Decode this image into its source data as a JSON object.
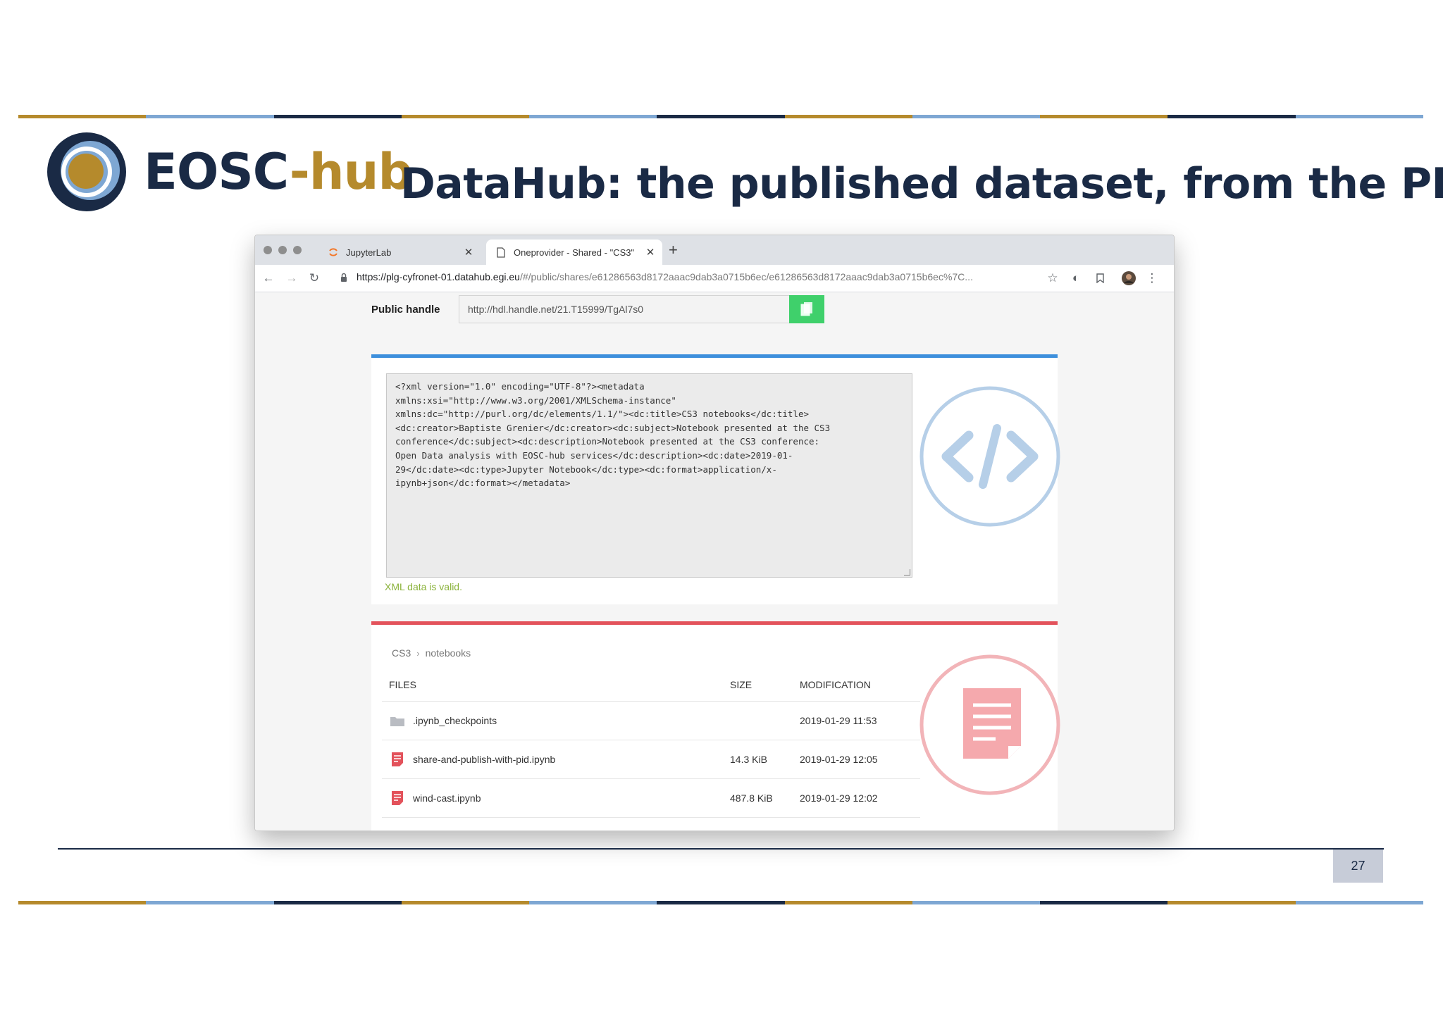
{
  "slide": {
    "logo": {
      "part1": "EOSC",
      "part2": "-hub"
    },
    "title": "DataHub: the published dataset, from the PID",
    "page_number": "27",
    "colors": {
      "navy": "#1a2a45",
      "gold": "#b58a2c",
      "light_blue": "#7ea7d3"
    }
  },
  "browser": {
    "tabs": [
      {
        "label": "JupyterLab",
        "icon": "jupyter-spinner-icon",
        "active": false
      },
      {
        "label": "Oneprovider - Shared - \"CS3\"",
        "icon": "document-icon",
        "active": true
      }
    ],
    "url_main": "https://plg-cyfronet-01.datahub.egi.eu",
    "url_rest": "/#/public/shares/e61286563d8172aaac9dab3a0715b6ec/e61286563d8172aaac9dab3a0715b6ec%7C...",
    "toolbar_icons": [
      "back-arrow-icon",
      "forward-arrow-icon",
      "reload-icon",
      "lock-icon",
      "star-icon",
      "extension-icon",
      "bookmark-icon",
      "profile-avatar",
      "more-menu-icon"
    ]
  },
  "share": {
    "public_handle_label": "Public handle",
    "public_handle_value": "http://hdl.handle.net/21.T15999/TgAl7s0",
    "xml_text": "<?xml version=\"1.0\" encoding=\"UTF-8\"?><metadata xmlns:xsi=\"http://www.w3.org/2001/XMLSchema-instance\" xmlns:dc=\"http://purl.org/dc/elements/1.1/\"><dc:title>CS3 notebooks</dc:title><dc:creator>Baptiste Grenier</dc:creator><dc:subject>Notebook presented at the CS3 conference</dc:subject><dc:description>Notebook presented at the CS3 conference: Open Data analysis with EOSC-hub services</dc:description><dc:date>2019-01-29</dc:date><dc:type>Jupyter Notebook</dc:type><dc:format>application/x-ipynb+json</dc:format></metadata>",
    "xml_lines": [
      "<?xml version=\"1.0\" encoding=\"UTF-8\"?><metadata",
      "xmlns:xsi=\"http://www.w3.org/2001/XMLSchema-instance\"",
      "xmlns:dc=\"http://purl.org/dc/elements/1.1/\"><dc:title>CS3 notebooks</dc:title>",
      "<dc:creator>Baptiste Grenier</dc:creator><dc:subject>Notebook presented at the CS3",
      "conference</dc:subject><dc:description>Notebook presented at the CS3 conference:",
      "Open Data analysis with EOSC-hub services</dc:description><dc:date>2019-01-",
      "29</dc:date><dc:type>Jupyter Notebook</dc:type><dc:format>application/x-",
      "ipynb+json</dc:format></metadata>"
    ],
    "xml_status": "XML data is valid.",
    "breadcrumb": [
      "CS3",
      "notebooks"
    ],
    "columns": {
      "files": "FILES",
      "size": "SIZE",
      "modification": "MODIFICATION"
    },
    "files": [
      {
        "name": ".ipynb_checkpoints",
        "size": "",
        "modified": "2019-01-29 11:53",
        "type": "folder"
      },
      {
        "name": "share-and-publish-with-pid.ipynb",
        "size": "14.3 KiB",
        "modified": "2019-01-29 12:05",
        "type": "file"
      },
      {
        "name": "wind-cast.ipynb",
        "size": "487.8 KiB",
        "modified": "2019-01-29 12:02",
        "type": "file"
      }
    ],
    "colors": {
      "blue_rule": "#3d8fdc",
      "red_rule": "#e3525b",
      "valid_green": "#8ab23a",
      "copy_green": "#3fd06b"
    }
  }
}
